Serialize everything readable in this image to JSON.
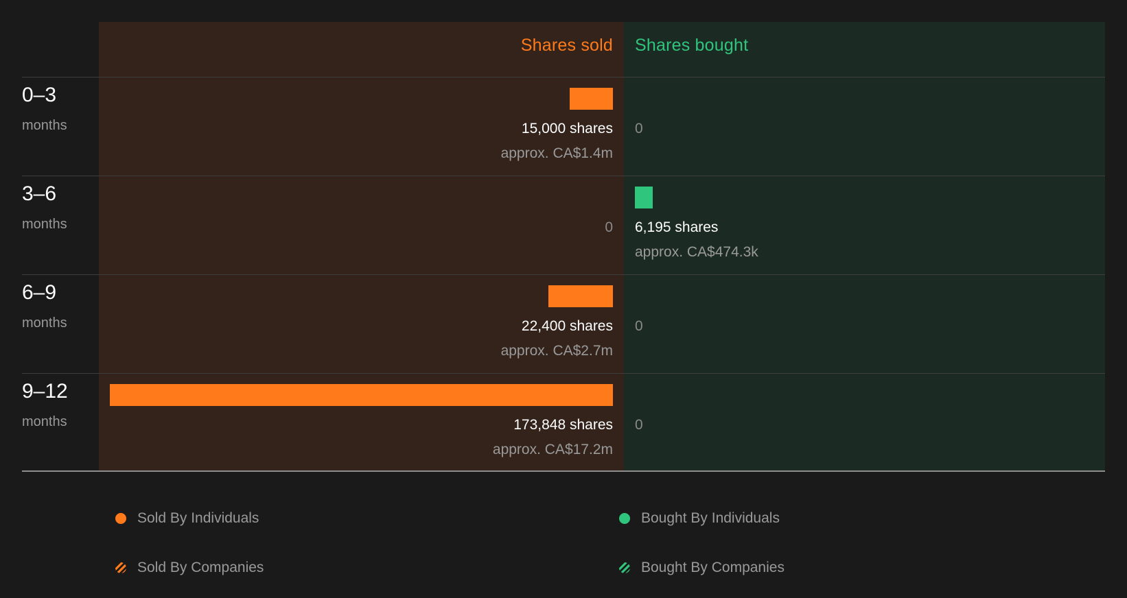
{
  "colors": {
    "sold": "#ff7a1a",
    "bought": "#2fc57c",
    "sold_panel": "#33231b",
    "bought_panel": "#1c2a24",
    "background": "#1a1a1b"
  },
  "header": {
    "sold": "Shares sold",
    "bought": "Shares bought"
  },
  "chart_data": {
    "type": "bar",
    "categories": [
      "0-3",
      "3-6",
      "6-9",
      "9-12"
    ],
    "category_unit": "months",
    "series": [
      {
        "name": "Shares sold",
        "values": [
          15000,
          0,
          22400,
          173848
        ],
        "labels": [
          "15,000 shares",
          "0",
          "22,400 shares",
          "173,848 shares"
        ],
        "approx": [
          "approx. CA$1.4m",
          "",
          "approx. CA$2.7m",
          "approx. CA$17.2m"
        ]
      },
      {
        "name": "Shares bought",
        "values": [
          0,
          6195,
          0,
          0
        ],
        "labels": [
          "0",
          "6,195 shares",
          "0",
          "0"
        ],
        "approx": [
          "",
          "approx. CA$474.3k",
          "",
          ""
        ]
      }
    ],
    "max_value": 173848
  },
  "legend": [
    {
      "label": "Sold By Individuals",
      "icon": "orange-dot-icon"
    },
    {
      "label": "Bought By Individuals",
      "icon": "green-dot-icon"
    },
    {
      "label": "Sold By Companies",
      "icon": "orange-hatch-icon"
    },
    {
      "label": "Bought By Companies",
      "icon": "green-hatch-icon"
    }
  ]
}
